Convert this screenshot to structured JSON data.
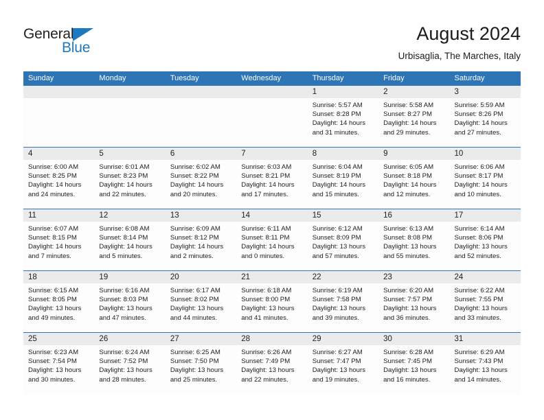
{
  "brand": {
    "name_part1": "General",
    "name_part2": "Blue",
    "color_dark": "#231f20",
    "color_blue": "#1e7ac0"
  },
  "header": {
    "title": "August 2024",
    "subtitle": "Urbisaglia, The Marches, Italy"
  },
  "theme": {
    "header_blue": "#2e75b6",
    "daynum_band": "#ebebeb",
    "cell_bg": "#fdfdfd"
  },
  "weekdays": [
    "Sunday",
    "Monday",
    "Tuesday",
    "Wednesday",
    "Thursday",
    "Friday",
    "Saturday"
  ],
  "weeks": [
    [
      {
        "day": "",
        "lines": []
      },
      {
        "day": "",
        "lines": []
      },
      {
        "day": "",
        "lines": []
      },
      {
        "day": "",
        "lines": []
      },
      {
        "day": "1",
        "lines": [
          "Sunrise: 5:57 AM",
          "Sunset: 8:28 PM",
          "Daylight: 14 hours",
          "and 31 minutes."
        ]
      },
      {
        "day": "2",
        "lines": [
          "Sunrise: 5:58 AM",
          "Sunset: 8:27 PM",
          "Daylight: 14 hours",
          "and 29 minutes."
        ]
      },
      {
        "day": "3",
        "lines": [
          "Sunrise: 5:59 AM",
          "Sunset: 8:26 PM",
          "Daylight: 14 hours",
          "and 27 minutes."
        ]
      }
    ],
    [
      {
        "day": "4",
        "lines": [
          "Sunrise: 6:00 AM",
          "Sunset: 8:25 PM",
          "Daylight: 14 hours",
          "and 24 minutes."
        ]
      },
      {
        "day": "5",
        "lines": [
          "Sunrise: 6:01 AM",
          "Sunset: 8:23 PM",
          "Daylight: 14 hours",
          "and 22 minutes."
        ]
      },
      {
        "day": "6",
        "lines": [
          "Sunrise: 6:02 AM",
          "Sunset: 8:22 PM",
          "Daylight: 14 hours",
          "and 20 minutes."
        ]
      },
      {
        "day": "7",
        "lines": [
          "Sunrise: 6:03 AM",
          "Sunset: 8:21 PM",
          "Daylight: 14 hours",
          "and 17 minutes."
        ]
      },
      {
        "day": "8",
        "lines": [
          "Sunrise: 6:04 AM",
          "Sunset: 8:19 PM",
          "Daylight: 14 hours",
          "and 15 minutes."
        ]
      },
      {
        "day": "9",
        "lines": [
          "Sunrise: 6:05 AM",
          "Sunset: 8:18 PM",
          "Daylight: 14 hours",
          "and 12 minutes."
        ]
      },
      {
        "day": "10",
        "lines": [
          "Sunrise: 6:06 AM",
          "Sunset: 8:17 PM",
          "Daylight: 14 hours",
          "and 10 minutes."
        ]
      }
    ],
    [
      {
        "day": "11",
        "lines": [
          "Sunrise: 6:07 AM",
          "Sunset: 8:15 PM",
          "Daylight: 14 hours",
          "and 7 minutes."
        ]
      },
      {
        "day": "12",
        "lines": [
          "Sunrise: 6:08 AM",
          "Sunset: 8:14 PM",
          "Daylight: 14 hours",
          "and 5 minutes."
        ]
      },
      {
        "day": "13",
        "lines": [
          "Sunrise: 6:09 AM",
          "Sunset: 8:12 PM",
          "Daylight: 14 hours",
          "and 2 minutes."
        ]
      },
      {
        "day": "14",
        "lines": [
          "Sunrise: 6:11 AM",
          "Sunset: 8:11 PM",
          "Daylight: 14 hours",
          "and 0 minutes."
        ]
      },
      {
        "day": "15",
        "lines": [
          "Sunrise: 6:12 AM",
          "Sunset: 8:09 PM",
          "Daylight: 13 hours",
          "and 57 minutes."
        ]
      },
      {
        "day": "16",
        "lines": [
          "Sunrise: 6:13 AM",
          "Sunset: 8:08 PM",
          "Daylight: 13 hours",
          "and 55 minutes."
        ]
      },
      {
        "day": "17",
        "lines": [
          "Sunrise: 6:14 AM",
          "Sunset: 8:06 PM",
          "Daylight: 13 hours",
          "and 52 minutes."
        ]
      }
    ],
    [
      {
        "day": "18",
        "lines": [
          "Sunrise: 6:15 AM",
          "Sunset: 8:05 PM",
          "Daylight: 13 hours",
          "and 49 minutes."
        ]
      },
      {
        "day": "19",
        "lines": [
          "Sunrise: 6:16 AM",
          "Sunset: 8:03 PM",
          "Daylight: 13 hours",
          "and 47 minutes."
        ]
      },
      {
        "day": "20",
        "lines": [
          "Sunrise: 6:17 AM",
          "Sunset: 8:02 PM",
          "Daylight: 13 hours",
          "and 44 minutes."
        ]
      },
      {
        "day": "21",
        "lines": [
          "Sunrise: 6:18 AM",
          "Sunset: 8:00 PM",
          "Daylight: 13 hours",
          "and 41 minutes."
        ]
      },
      {
        "day": "22",
        "lines": [
          "Sunrise: 6:19 AM",
          "Sunset: 7:58 PM",
          "Daylight: 13 hours",
          "and 39 minutes."
        ]
      },
      {
        "day": "23",
        "lines": [
          "Sunrise: 6:20 AM",
          "Sunset: 7:57 PM",
          "Daylight: 13 hours",
          "and 36 minutes."
        ]
      },
      {
        "day": "24",
        "lines": [
          "Sunrise: 6:22 AM",
          "Sunset: 7:55 PM",
          "Daylight: 13 hours",
          "and 33 minutes."
        ]
      }
    ],
    [
      {
        "day": "25",
        "lines": [
          "Sunrise: 6:23 AM",
          "Sunset: 7:54 PM",
          "Daylight: 13 hours",
          "and 30 minutes."
        ]
      },
      {
        "day": "26",
        "lines": [
          "Sunrise: 6:24 AM",
          "Sunset: 7:52 PM",
          "Daylight: 13 hours",
          "and 28 minutes."
        ]
      },
      {
        "day": "27",
        "lines": [
          "Sunrise: 6:25 AM",
          "Sunset: 7:50 PM",
          "Daylight: 13 hours",
          "and 25 minutes."
        ]
      },
      {
        "day": "28",
        "lines": [
          "Sunrise: 6:26 AM",
          "Sunset: 7:49 PM",
          "Daylight: 13 hours",
          "and 22 minutes."
        ]
      },
      {
        "day": "29",
        "lines": [
          "Sunrise: 6:27 AM",
          "Sunset: 7:47 PM",
          "Daylight: 13 hours",
          "and 19 minutes."
        ]
      },
      {
        "day": "30",
        "lines": [
          "Sunrise: 6:28 AM",
          "Sunset: 7:45 PM",
          "Daylight: 13 hours",
          "and 16 minutes."
        ]
      },
      {
        "day": "31",
        "lines": [
          "Sunrise: 6:29 AM",
          "Sunset: 7:43 PM",
          "Daylight: 13 hours",
          "and 14 minutes."
        ]
      }
    ]
  ]
}
